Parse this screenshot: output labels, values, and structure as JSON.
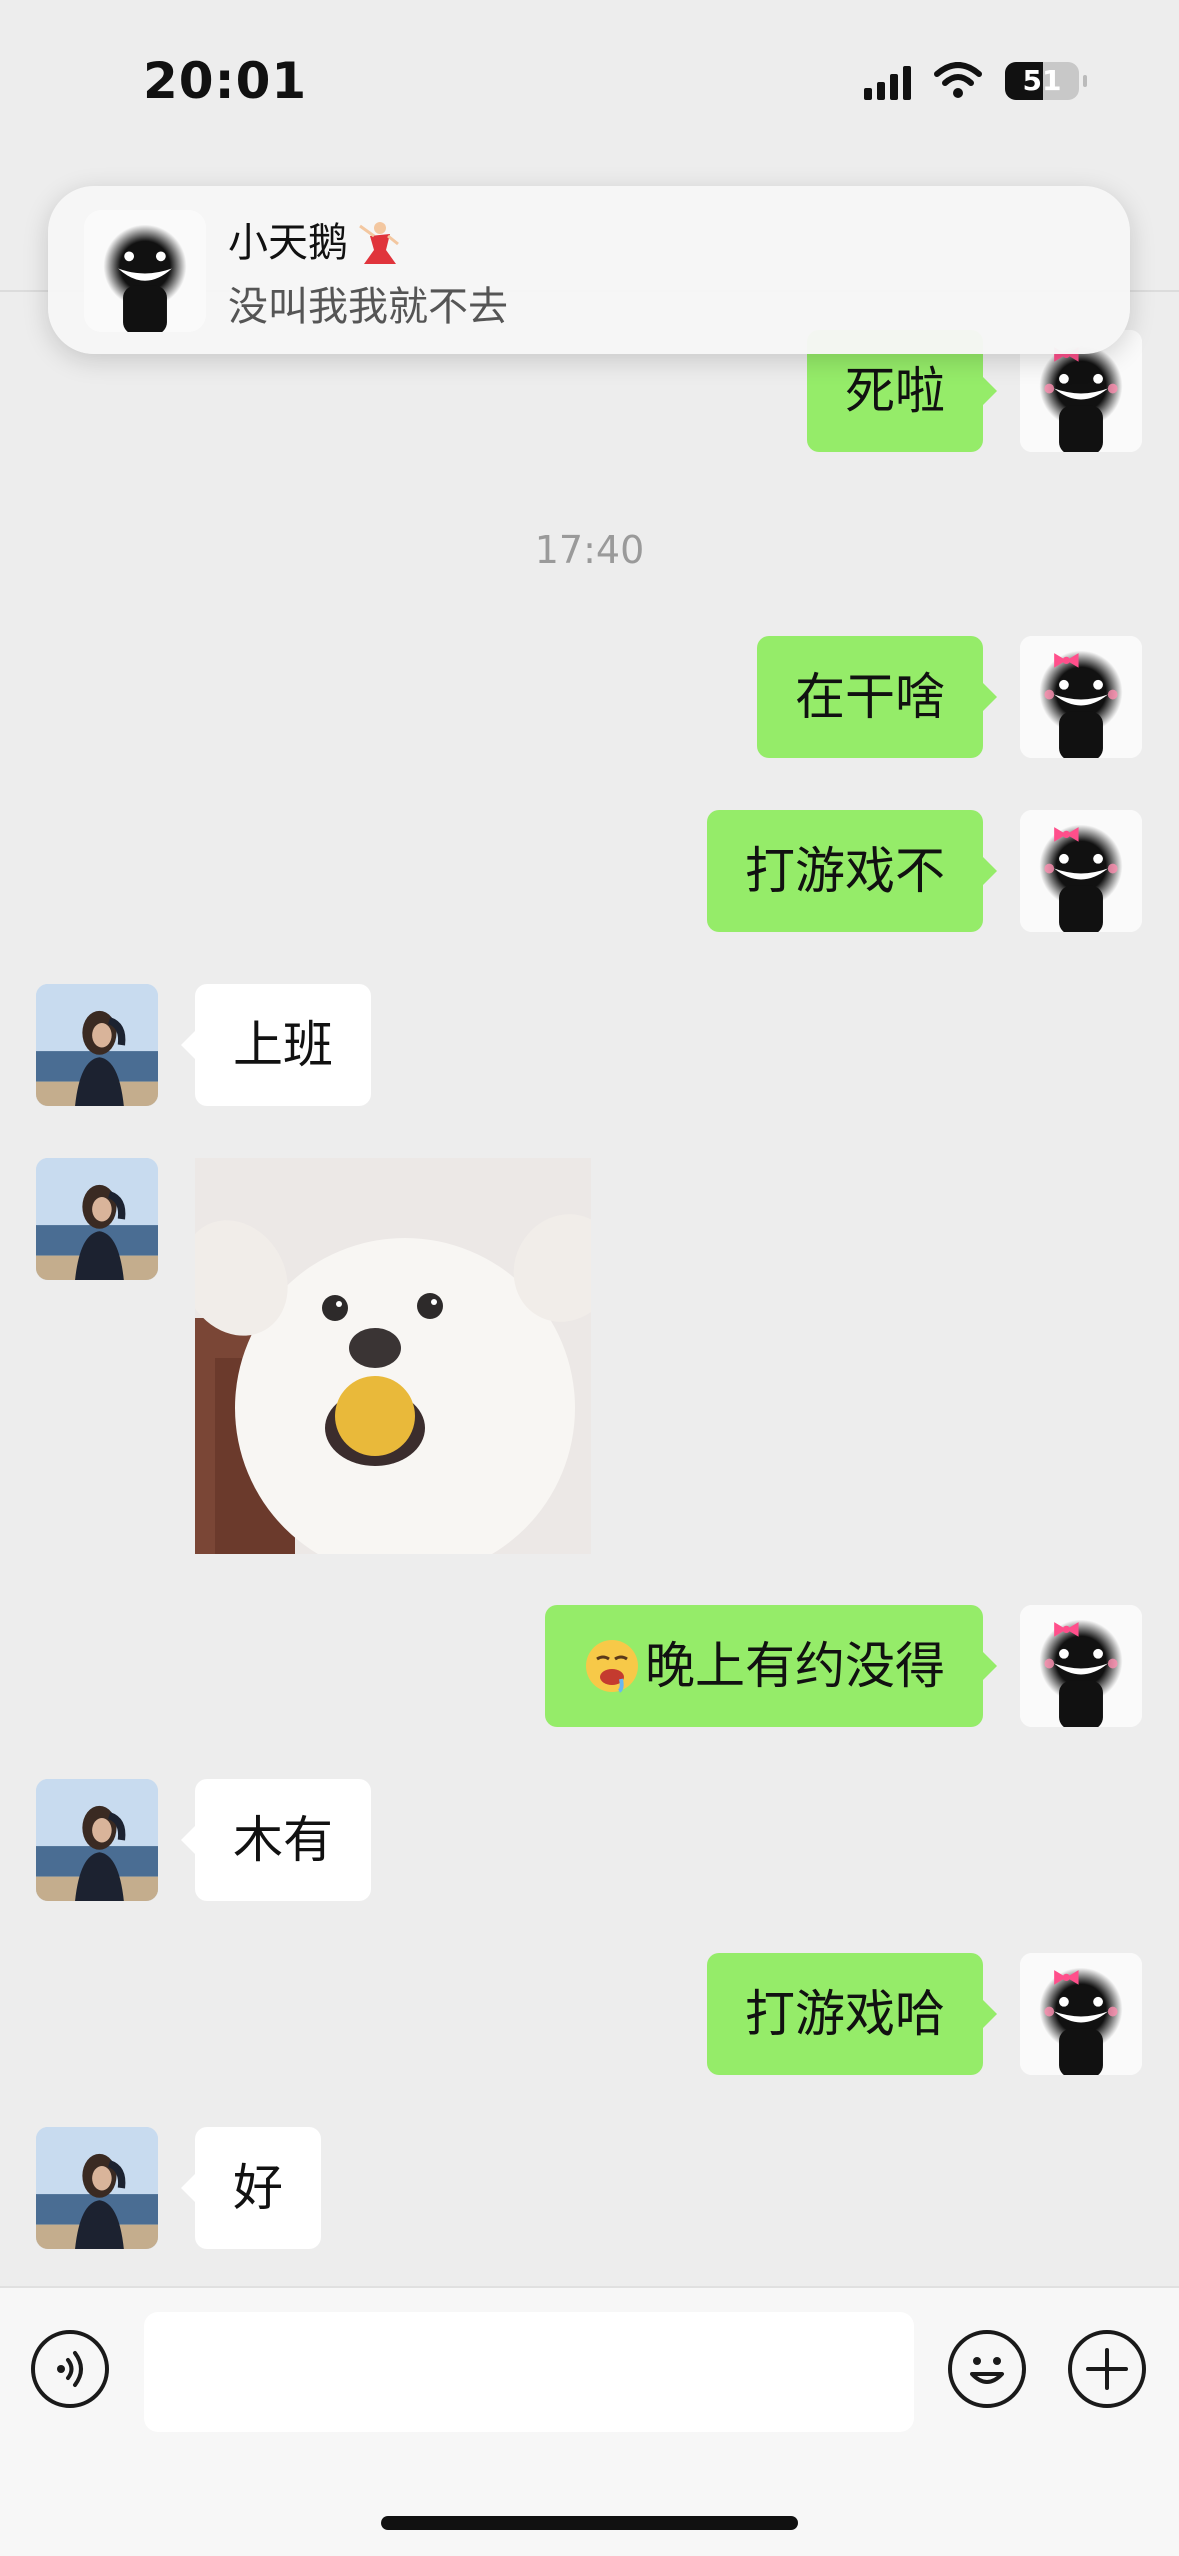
{
  "status": {
    "time": "20:01",
    "battery": "51"
  },
  "notification": {
    "sender": "小天鹅",
    "sender_emoji_icon": "ballet-dancer-icon",
    "message": "没叫我我就不去"
  },
  "messages": [
    {
      "from": "me",
      "text": "死啦"
    },
    {
      "type": "timestamp",
      "text": "17:40"
    },
    {
      "from": "me",
      "text": "在干啥"
    },
    {
      "from": "me",
      "text": "打游戏不"
    },
    {
      "from": "peer",
      "text": "上班"
    },
    {
      "from": "peer",
      "type": "image",
      "icon": "dog-photo"
    },
    {
      "from": "me",
      "text": "晚上有约没得",
      "emoji_icon": "drooling-face-icon"
    },
    {
      "from": "peer",
      "text": "木有"
    },
    {
      "from": "me",
      "text": "打游戏哈"
    },
    {
      "from": "peer",
      "text": "好"
    }
  ],
  "input": {
    "placeholder": ""
  },
  "colors": {
    "background": "#ededed",
    "my_bubble": "#95ec69",
    "peer_bubble": "#ffffff"
  }
}
